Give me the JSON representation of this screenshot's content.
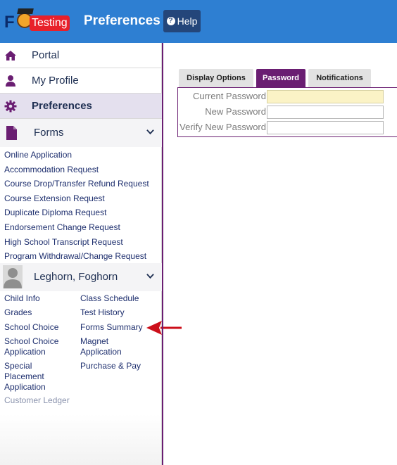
{
  "header": {
    "logo_badge": "Testing",
    "title": "Preferences",
    "help_label": "Help",
    "help_icon": "question-circle-icon",
    "background_color": "#2e7fd2"
  },
  "sidebar": {
    "nav": [
      {
        "label": "Portal",
        "icon": "home-icon"
      },
      {
        "label": "My Profile",
        "icon": "user-icon"
      },
      {
        "label": "Preferences",
        "icon": "gear-icon",
        "active": true
      }
    ],
    "forms": {
      "label": "Forms",
      "icon": "document-icon",
      "links": [
        "Online Application",
        "Accommodation Request",
        "Course Drop/Transfer Refund Request",
        "Course Extension Request",
        "Duplicate Diploma Request",
        "Endorsement Change Request",
        "High School Transcript Request",
        "Program Withdrawal/Change Request"
      ]
    },
    "student": {
      "name": "Leghorn, Foghorn",
      "links_left": [
        "Child Info",
        "Grades",
        "School Choice",
        "School Choice Application",
        "Special Placement Application",
        "Customer Ledger"
      ],
      "links_right": [
        "Class Schedule",
        "Test History",
        "Forms Summary",
        "Magnet Application",
        "Purchase & Pay"
      ]
    }
  },
  "main": {
    "tabs": [
      "Display Options",
      "Password",
      "Notifications"
    ],
    "active_tab": "Password",
    "fields": [
      {
        "label": "Current Password",
        "value": ""
      },
      {
        "label": "New Password",
        "value": ""
      },
      {
        "label": "Verify New Password",
        "value": ""
      }
    ],
    "accent_color": "#6a1e72"
  }
}
